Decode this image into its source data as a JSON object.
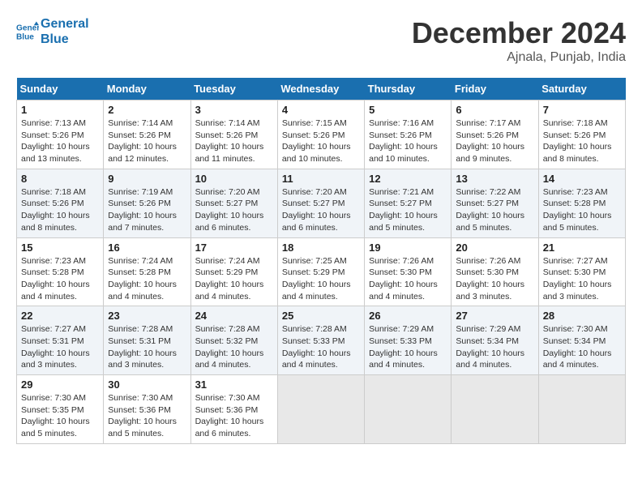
{
  "header": {
    "logo_line1": "General",
    "logo_line2": "Blue",
    "month": "December 2024",
    "location": "Ajnala, Punjab, India"
  },
  "weekdays": [
    "Sunday",
    "Monday",
    "Tuesday",
    "Wednesday",
    "Thursday",
    "Friday",
    "Saturday"
  ],
  "weeks": [
    [
      {
        "day": "1",
        "lines": [
          "Sunrise: 7:13 AM",
          "Sunset: 5:26 PM",
          "Daylight: 10 hours",
          "and 13 minutes."
        ]
      },
      {
        "day": "2",
        "lines": [
          "Sunrise: 7:14 AM",
          "Sunset: 5:26 PM",
          "Daylight: 10 hours",
          "and 12 minutes."
        ]
      },
      {
        "day": "3",
        "lines": [
          "Sunrise: 7:14 AM",
          "Sunset: 5:26 PM",
          "Daylight: 10 hours",
          "and 11 minutes."
        ]
      },
      {
        "day": "4",
        "lines": [
          "Sunrise: 7:15 AM",
          "Sunset: 5:26 PM",
          "Daylight: 10 hours",
          "and 10 minutes."
        ]
      },
      {
        "day": "5",
        "lines": [
          "Sunrise: 7:16 AM",
          "Sunset: 5:26 PM",
          "Daylight: 10 hours",
          "and 10 minutes."
        ]
      },
      {
        "day": "6",
        "lines": [
          "Sunrise: 7:17 AM",
          "Sunset: 5:26 PM",
          "Daylight: 10 hours",
          "and 9 minutes."
        ]
      },
      {
        "day": "7",
        "lines": [
          "Sunrise: 7:18 AM",
          "Sunset: 5:26 PM",
          "Daylight: 10 hours",
          "and 8 minutes."
        ]
      }
    ],
    [
      {
        "day": "8",
        "lines": [
          "Sunrise: 7:18 AM",
          "Sunset: 5:26 PM",
          "Daylight: 10 hours",
          "and 8 minutes."
        ]
      },
      {
        "day": "9",
        "lines": [
          "Sunrise: 7:19 AM",
          "Sunset: 5:26 PM",
          "Daylight: 10 hours",
          "and 7 minutes."
        ]
      },
      {
        "day": "10",
        "lines": [
          "Sunrise: 7:20 AM",
          "Sunset: 5:27 PM",
          "Daylight: 10 hours",
          "and 6 minutes."
        ]
      },
      {
        "day": "11",
        "lines": [
          "Sunrise: 7:20 AM",
          "Sunset: 5:27 PM",
          "Daylight: 10 hours",
          "and 6 minutes."
        ]
      },
      {
        "day": "12",
        "lines": [
          "Sunrise: 7:21 AM",
          "Sunset: 5:27 PM",
          "Daylight: 10 hours",
          "and 5 minutes."
        ]
      },
      {
        "day": "13",
        "lines": [
          "Sunrise: 7:22 AM",
          "Sunset: 5:27 PM",
          "Daylight: 10 hours",
          "and 5 minutes."
        ]
      },
      {
        "day": "14",
        "lines": [
          "Sunrise: 7:23 AM",
          "Sunset: 5:28 PM",
          "Daylight: 10 hours",
          "and 5 minutes."
        ]
      }
    ],
    [
      {
        "day": "15",
        "lines": [
          "Sunrise: 7:23 AM",
          "Sunset: 5:28 PM",
          "Daylight: 10 hours",
          "and 4 minutes."
        ]
      },
      {
        "day": "16",
        "lines": [
          "Sunrise: 7:24 AM",
          "Sunset: 5:28 PM",
          "Daylight: 10 hours",
          "and 4 minutes."
        ]
      },
      {
        "day": "17",
        "lines": [
          "Sunrise: 7:24 AM",
          "Sunset: 5:29 PM",
          "Daylight: 10 hours",
          "and 4 minutes."
        ]
      },
      {
        "day": "18",
        "lines": [
          "Sunrise: 7:25 AM",
          "Sunset: 5:29 PM",
          "Daylight: 10 hours",
          "and 4 minutes."
        ]
      },
      {
        "day": "19",
        "lines": [
          "Sunrise: 7:26 AM",
          "Sunset: 5:30 PM",
          "Daylight: 10 hours",
          "and 4 minutes."
        ]
      },
      {
        "day": "20",
        "lines": [
          "Sunrise: 7:26 AM",
          "Sunset: 5:30 PM",
          "Daylight: 10 hours",
          "and 3 minutes."
        ]
      },
      {
        "day": "21",
        "lines": [
          "Sunrise: 7:27 AM",
          "Sunset: 5:30 PM",
          "Daylight: 10 hours",
          "and 3 minutes."
        ]
      }
    ],
    [
      {
        "day": "22",
        "lines": [
          "Sunrise: 7:27 AM",
          "Sunset: 5:31 PM",
          "Daylight: 10 hours",
          "and 3 minutes."
        ]
      },
      {
        "day": "23",
        "lines": [
          "Sunrise: 7:28 AM",
          "Sunset: 5:31 PM",
          "Daylight: 10 hours",
          "and 3 minutes."
        ]
      },
      {
        "day": "24",
        "lines": [
          "Sunrise: 7:28 AM",
          "Sunset: 5:32 PM",
          "Daylight: 10 hours",
          "and 4 minutes."
        ]
      },
      {
        "day": "25",
        "lines": [
          "Sunrise: 7:28 AM",
          "Sunset: 5:33 PM",
          "Daylight: 10 hours",
          "and 4 minutes."
        ]
      },
      {
        "day": "26",
        "lines": [
          "Sunrise: 7:29 AM",
          "Sunset: 5:33 PM",
          "Daylight: 10 hours",
          "and 4 minutes."
        ]
      },
      {
        "day": "27",
        "lines": [
          "Sunrise: 7:29 AM",
          "Sunset: 5:34 PM",
          "Daylight: 10 hours",
          "and 4 minutes."
        ]
      },
      {
        "day": "28",
        "lines": [
          "Sunrise: 7:30 AM",
          "Sunset: 5:34 PM",
          "Daylight: 10 hours",
          "and 4 minutes."
        ]
      }
    ],
    [
      {
        "day": "29",
        "lines": [
          "Sunrise: 7:30 AM",
          "Sunset: 5:35 PM",
          "Daylight: 10 hours",
          "and 5 minutes."
        ]
      },
      {
        "day": "30",
        "lines": [
          "Sunrise: 7:30 AM",
          "Sunset: 5:36 PM",
          "Daylight: 10 hours",
          "and 5 minutes."
        ]
      },
      {
        "day": "31",
        "lines": [
          "Sunrise: 7:30 AM",
          "Sunset: 5:36 PM",
          "Daylight: 10 hours",
          "and 6 minutes."
        ]
      },
      {
        "day": "",
        "lines": []
      },
      {
        "day": "",
        "lines": []
      },
      {
        "day": "",
        "lines": []
      },
      {
        "day": "",
        "lines": []
      }
    ]
  ]
}
